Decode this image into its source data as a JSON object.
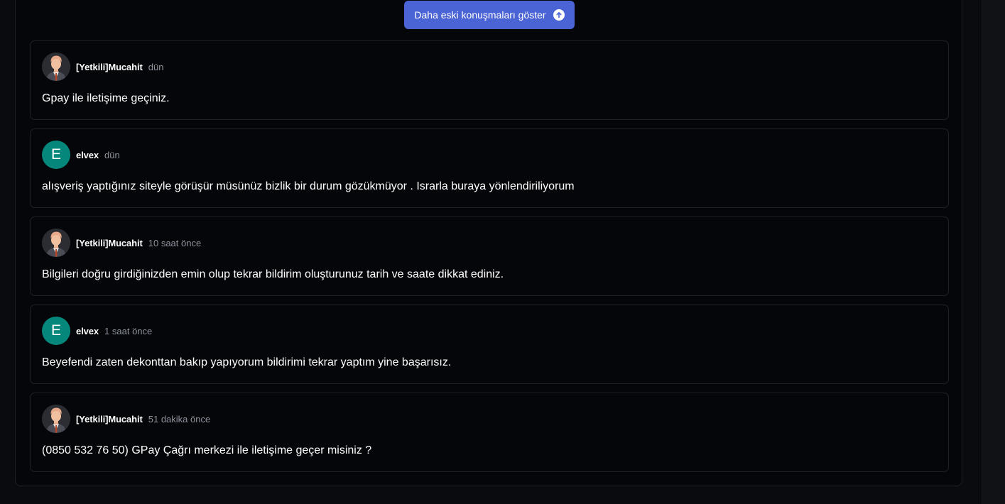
{
  "thread": {
    "show_older_label": "Daha eski konuşmaları göster",
    "show_older_icon": "arrow-up-circle-icon",
    "messages": [
      {
        "author": "[Yetkili]Mucahit",
        "avatar_type": "staff-avatar-icon",
        "time": "dün",
        "text": "Gpay ile iletişime geçiniz."
      },
      {
        "author": "elvex",
        "avatar_letter": "E",
        "avatar_color": "#06877b",
        "time": "dün",
        "text": "alışveriş yaptığınız siteyle görüşür müsünüz bizlik bir durum gözükmüyor . Israrla buraya yönlendiriliyorum"
      },
      {
        "author": "[Yetkili]Mucahit",
        "avatar_type": "staff-avatar-icon",
        "time": "10 saat önce",
        "text": "Bilgileri doğru girdiğinizden emin olup tekrar bildirim oluşturunuz tarih ve saate dikkat ediniz."
      },
      {
        "author": "elvex",
        "avatar_letter": "E",
        "avatar_color": "#06877b",
        "time": "1 saat önce",
        "text": "Beyefendi zaten dekonttan bakıp yapıyorum bildirimi tekrar yaptım yine başarısız."
      },
      {
        "author": "[Yetkili]Mucahit",
        "avatar_type": "staff-avatar-icon",
        "time": "51 dakika önce",
        "text": "(0850 532 76 50) GPay Çağrı merkezi ile iletişime geçer misiniz ?"
      }
    ]
  },
  "colors": {
    "button": "#4a64d6",
    "background": "#05060a",
    "border": "#1f2229",
    "muted_text": "#8e939c"
  }
}
